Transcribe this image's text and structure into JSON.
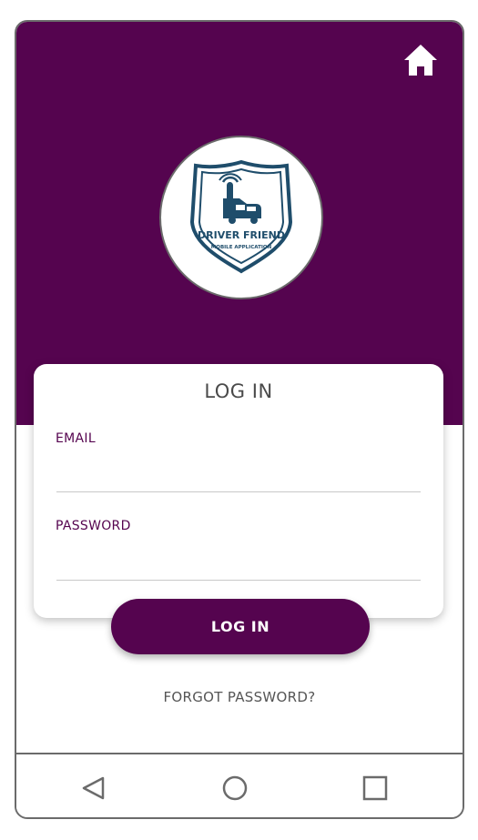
{
  "header": {
    "home_icon": "home-icon",
    "background_color": "#55044f"
  },
  "logo": {
    "brand_name": "DRIVER FRIEND",
    "tagline": "MOBILE APPLICATION",
    "icon": "shield-car-tap-icon"
  },
  "login_form": {
    "title": "LOG IN",
    "email_label": "EMAIL",
    "email_value": "",
    "password_label": "PASSWORD",
    "password_value": "",
    "submit_label": "LOG IN",
    "forgot_label": "FORGOT PASSWORD?"
  },
  "nav_bar": {
    "back_icon": "triangle-back-icon",
    "home_icon": "circle-home-icon",
    "recents_icon": "square-recents-icon"
  },
  "colors": {
    "accent": "#55044f",
    "logo_blue": "#1f4d6b",
    "text_gray": "#555555"
  }
}
